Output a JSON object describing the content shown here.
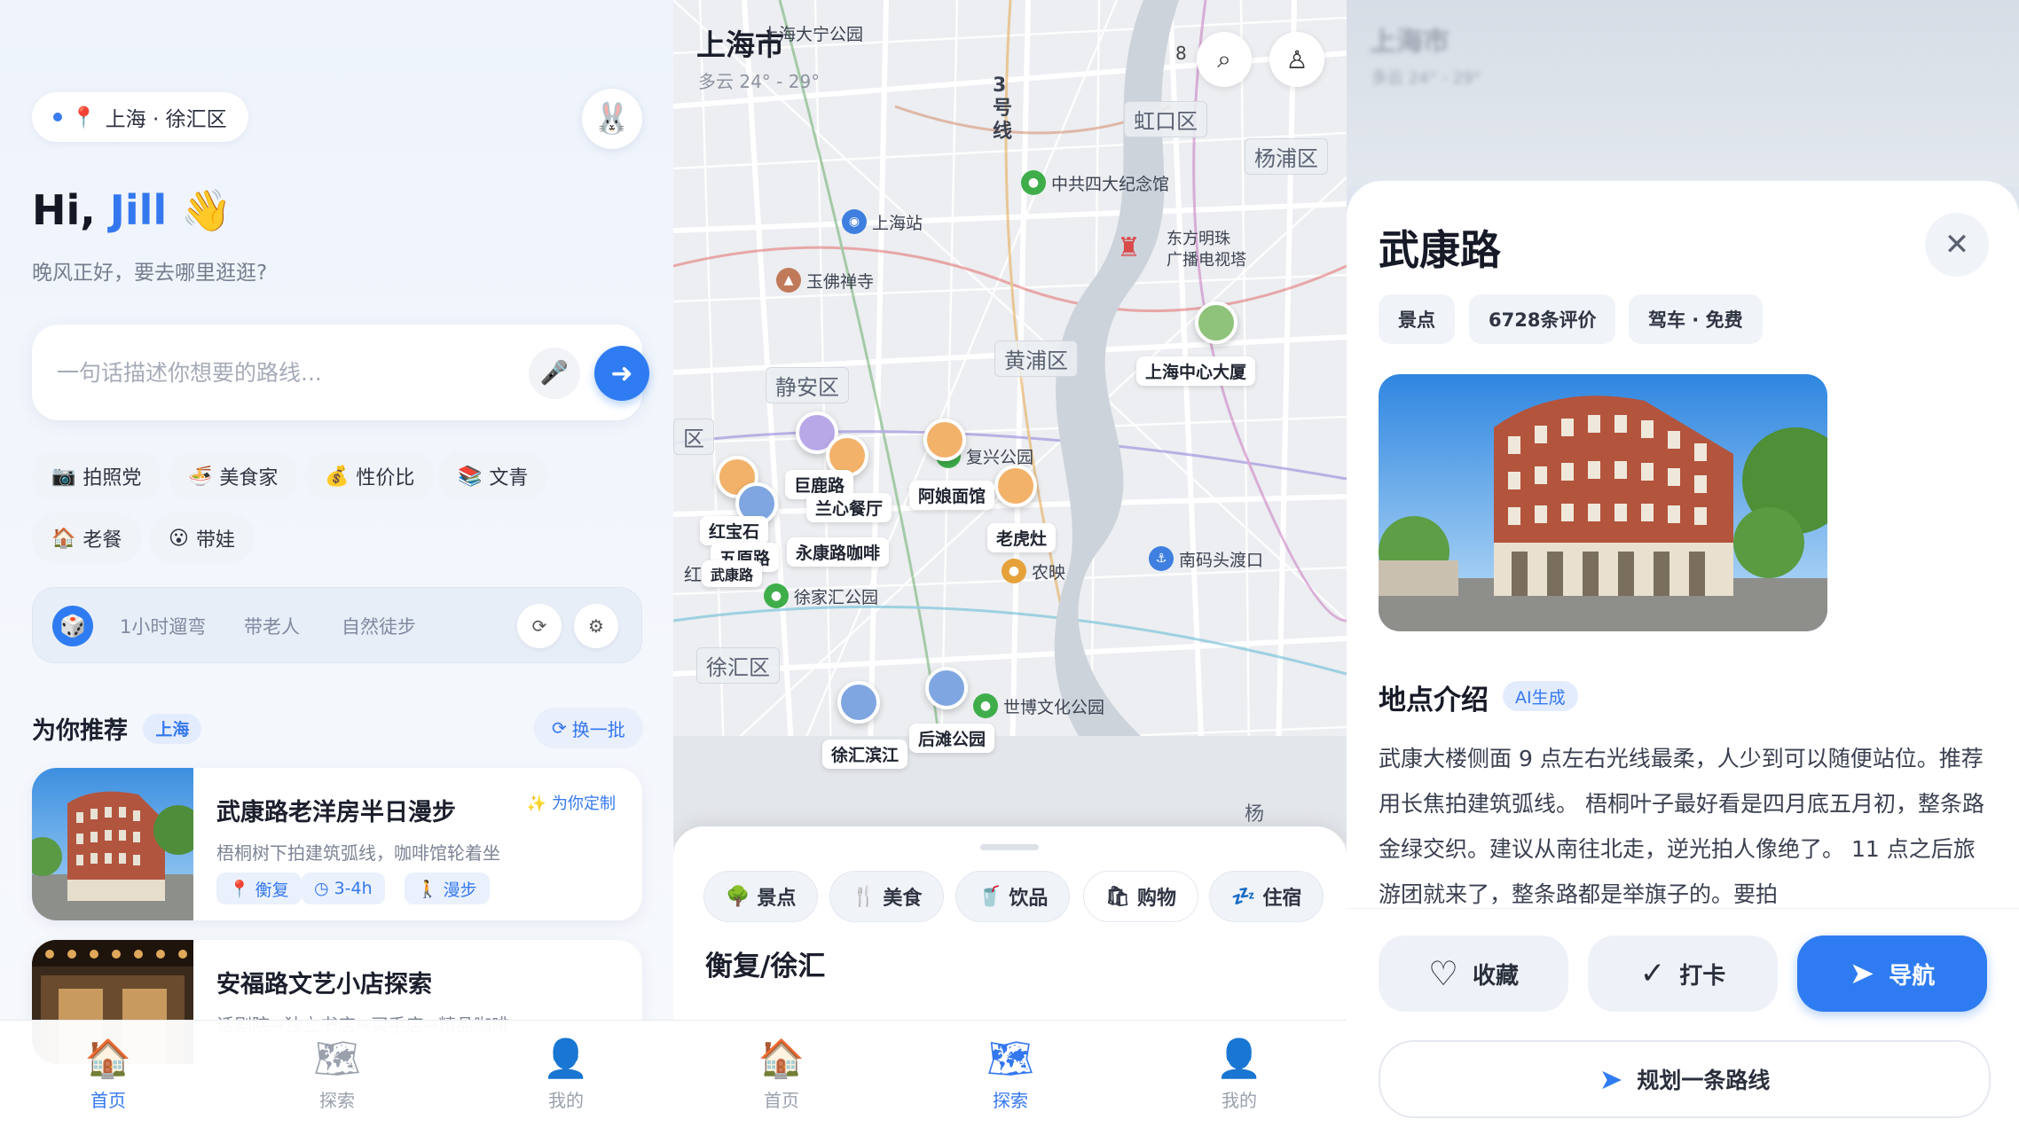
{
  "home": {
    "location": "上海 · 徐汇区",
    "greeting_hi": "Hi,",
    "greeting_name": "Jill",
    "greeting_wave": "👋",
    "subtitle": "晚风正好，要去哪里逛逛?",
    "search_placeholder": "一句话描述你想要的路线...",
    "chips": [
      {
        "icon": "📷",
        "label": "拍照党"
      },
      {
        "icon": "🍜",
        "label": "美食家"
      },
      {
        "icon": "💰",
        "label": "性价比"
      },
      {
        "icon": "📚",
        "label": "文青"
      },
      {
        "icon": "🏠",
        "label": "老餐"
      },
      {
        "icon": "😮",
        "label": "带娃"
      }
    ],
    "quick": [
      "1小时遛弯",
      "带老人",
      "自然徒步"
    ],
    "section_title": "为你推荐",
    "section_tag": "上海",
    "refresh": "换一批",
    "cards": [
      {
        "title": "武康路老洋房半日漫步",
        "desc": "梧桐树下拍建筑弧线，咖啡馆轮着坐",
        "custom": "✨ 为你定制",
        "tags": [
          "衡复",
          "3-4h",
          "漫步"
        ]
      },
      {
        "title": "安福路文艺小店探索",
        "desc": "话剧院→独立书店→买手店→精品咖啡"
      }
    ]
  },
  "tabs": [
    "首页",
    "探索",
    "我的"
  ],
  "map": {
    "city": "上海市",
    "weather": "多云 24° - 29°",
    "count_badge": "8",
    "districts": [
      "虹口区",
      "杨浦区",
      "静安区",
      "黄浦区",
      "徐汇区",
      "区"
    ],
    "pois": [
      "上海大宁公园",
      "中共四大纪念馆",
      "上海站",
      "玉佛禅寺",
      "东方明珠",
      "广播电视塔",
      "复兴公园",
      "南码头渡口",
      "徐家汇公园",
      "农映",
      "世博文化公园",
      "红"
    ],
    "labels": [
      "上海中心大厦",
      "巨鹿路",
      "兰心餐厅",
      "阿娘面馆",
      "红宝石",
      "五原路",
      "永康路咖啡",
      "武康路",
      "老虎灶",
      "徐汇滨江",
      "后滩公园"
    ],
    "metro": "3号线",
    "corner": "杨",
    "categories": [
      {
        "icon": "🌳",
        "label": "景点"
      },
      {
        "icon": "🍴",
        "label": "美食"
      },
      {
        "icon": "🥤",
        "label": "饮品"
      },
      {
        "icon": "🛍",
        "label": "购物"
      },
      {
        "icon": "💤",
        "label": "住宿"
      }
    ],
    "sheet_title": "衡复/徐汇"
  },
  "detail": {
    "title": "武康路",
    "tags": [
      "景点",
      "6728条评价",
      "驾车 · 免费"
    ],
    "intro_title": "地点介绍",
    "ai_tag": "AI生成",
    "description": "武康大楼侧面 9 点左右光线最柔，人少到可以随便站位。推荐用长焦拍建筑弧线。 梧桐叶子最好看是四月底五月初，整条路金绿交织。建议从南往北走，逆光拍人像绝了。 11 点之后旅游团就来了，整条路都是举旗子的。要拍",
    "actions": [
      "收藏",
      "打卡",
      "导航"
    ],
    "plan": "规划一条路线",
    "ghost_city": "上海市",
    "ghost_weather": "多云 24° - 29°"
  }
}
